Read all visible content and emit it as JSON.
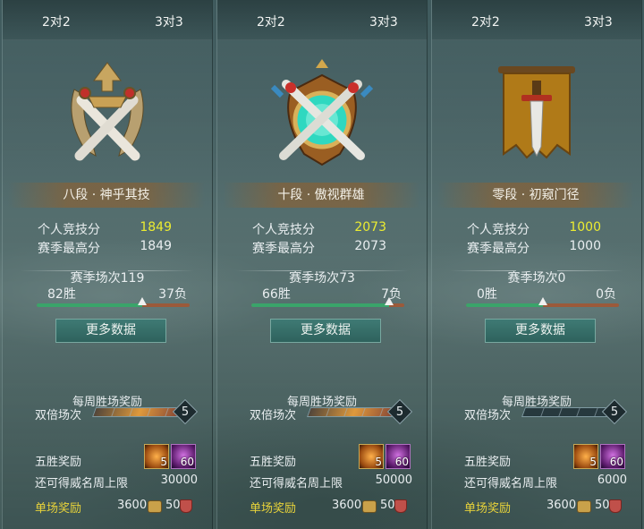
{
  "panels": [
    {
      "tabs": [
        "2对2",
        "3对3"
      ],
      "rank_title": "八段 · 神乎其技",
      "emblem_icon": "crossed-swords-laurel-emblem-icon",
      "personal_score_label": "个人竞技分",
      "personal_score": "1849",
      "season_high_label": "赛季最高分",
      "season_high": "1849",
      "season_matches": "赛季场次119",
      "wins": "82胜",
      "losses": "37负",
      "win_ratio": 0.69,
      "more_button": "更多数据",
      "weekly_title": "每周胜场奖励",
      "double_label": "双倍场次",
      "double_count": "5",
      "double_progress": 1.0,
      "five_win_label": "五胜奖励",
      "items": [
        {
          "icon": "scroll-item-icon",
          "qty": "5"
        },
        {
          "icon": "purple-gem-item-icon",
          "qty": "60"
        }
      ],
      "cap_label": "还可得威名周上限",
      "cap_value": "30000",
      "single_label": "单场奖励",
      "single_coin": "3600",
      "single_shield": "50"
    },
    {
      "tabs": [
        "2对2",
        "3对3"
      ],
      "rank_title": "十段 · 傲视群雄",
      "emblem_icon": "crossed-swords-jade-orb-emblem-icon",
      "personal_score_label": "个人竞技分",
      "personal_score": "2073",
      "season_high_label": "赛季最高分",
      "season_high": "2073",
      "season_matches": "赛季场次73",
      "wins": "66胜",
      "losses": "7负",
      "win_ratio": 0.9,
      "more_button": "更多数据",
      "weekly_title": "每周胜场奖励",
      "double_label": "双倍场次",
      "double_count": "5",
      "double_progress": 1.0,
      "five_win_label": "五胜奖励",
      "items": [
        {
          "icon": "scroll-item-icon",
          "qty": "5"
        },
        {
          "icon": "purple-gem-item-icon",
          "qty": "60"
        }
      ],
      "cap_label": "还可得威名周上限",
      "cap_value": "50000",
      "single_label": "单场奖励",
      "single_coin": "3600",
      "single_shield": "50"
    },
    {
      "tabs": [
        "2对2",
        "3对3"
      ],
      "rank_title": "零段 · 初窥门径",
      "emblem_icon": "banner-sword-emblem-icon",
      "personal_score_label": "个人竞技分",
      "personal_score": "1000",
      "season_high_label": "赛季最高分",
      "season_high": "1000",
      "season_matches": "赛季场次0",
      "wins": "0胜",
      "losses": "0负",
      "win_ratio": 0.5,
      "more_button": "更多数据",
      "weekly_title": "每周胜场奖励",
      "double_label": "双倍场次",
      "double_count": "5",
      "double_progress": 0.0,
      "five_win_label": "五胜奖励",
      "items": [
        {
          "icon": "scroll-item-icon",
          "qty": "5"
        },
        {
          "icon": "purple-gem-item-icon",
          "qty": "60"
        }
      ],
      "cap_label": "还可得威名周上限",
      "cap_value": "6000",
      "single_label": "单场奖励",
      "single_coin": "3600",
      "single_shield": "50"
    }
  ],
  "colors": {
    "highlight": "#ecec31",
    "win_bar": "#3aa46a",
    "loss_bar": "#9b5a3a",
    "single_label": "#e8d33a",
    "button": "#2e625d"
  }
}
